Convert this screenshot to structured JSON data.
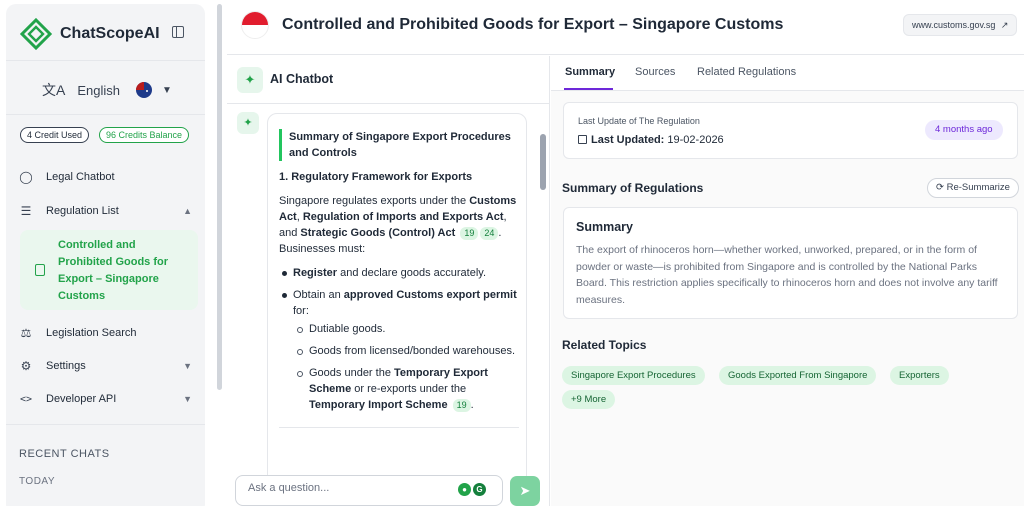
{
  "app": {
    "name": "ChatScopeAI"
  },
  "language": {
    "label": "English",
    "flag": "australia-flag"
  },
  "credits": {
    "used": "4 Credit Used",
    "balance": "96 Credits Balance"
  },
  "sidebar": {
    "items": [
      {
        "label": "Legal Chatbot",
        "icon": "chat-bubble-icon"
      },
      {
        "label": "Regulation List",
        "icon": "list-icon"
      },
      {
        "label": "Legislation Search",
        "icon": "scales-icon"
      },
      {
        "label": "Settings",
        "icon": "gear-icon"
      },
      {
        "label": "Developer API",
        "icon": "code-icon"
      }
    ],
    "active_sub": "Controlled and Prohibited Goods for Export – Singapore Customs",
    "recent_title": "RECENT CHATS",
    "today": "TODAY"
  },
  "header": {
    "title": "Controlled and Prohibited Goods for Export – Singapore Customs",
    "url": "www.customs.gov.sg",
    "flag": "singapore-flag"
  },
  "chat": {
    "title": "AI Chatbot",
    "summary_heading": "Summary of Singapore Export Procedures and Controls",
    "section1": "1. Regulatory Framework for Exports",
    "para1_a": "Singapore regulates exports under the ",
    "para1_b": "Customs Act",
    "para1_c": ", ",
    "para1_d": "Regulation of Imports and Exports Act",
    "para1_e": ", and ",
    "para1_f": "Strategic Goods (Control) Act",
    "cite1": "19",
    "cite2": "24",
    "para1_g": ".",
    "para1_h": "Businesses must:",
    "b1_bold": "Register",
    "b1_rest": " and declare goods accurately.",
    "b2_a": "Obtain an ",
    "b2_bold": "approved Customs export permit",
    "b2_rest": " for:",
    "s1": "Dutiable goods.",
    "s2": "Goods from licensed/bonded warehouses.",
    "s3_a": "Goods under the ",
    "s3_b": "Temporary Export Scheme",
    "s3_c": " or re-exports under the ",
    "s3_d": "Temporary Import Scheme",
    "cite3": "19",
    "s3_e": ".",
    "input_placeholder": "Ask a question..."
  },
  "right": {
    "tabs": [
      "Summary",
      "Sources",
      "Related Regulations"
    ],
    "update_label": "Last Update of The Regulation",
    "last_updated_key": "Last Updated:",
    "last_updated_value": "19-02-2026",
    "age_badge": "4 months ago",
    "summary_section": "Summary of Regulations",
    "resummarize": "Re-Summarize",
    "summary_title": "Summary",
    "summary_text": "The export of rhinoceros horn—whether worked, unworked, prepared, or in the form of powder or waste—is prohibited from Singapore and is controlled by the National Parks Board. This restriction applies specifically to rhinoceros horn and does not involve any tariff measures.",
    "topics_title": "Related Topics",
    "topics": [
      "Singapore Export Procedures",
      "Goods Exported From Singapore",
      "Exporters"
    ],
    "more": "+9 More"
  },
  "colors": {
    "accent": "#22a34a",
    "tab_underline": "#6d28d9",
    "badge_bg": "#ede9fe"
  }
}
